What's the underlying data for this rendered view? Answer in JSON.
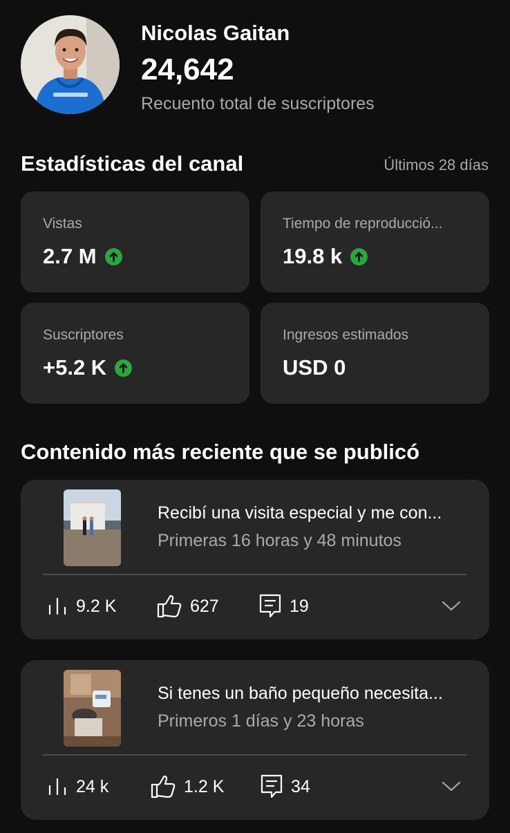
{
  "channel": {
    "name": "Nicolas Gaitan",
    "subscribers": "24,642",
    "subscribers_label": "Recuento total de suscriptores"
  },
  "stats": {
    "title": "Estadísticas del canal",
    "period": "Últimos 28 días",
    "cards": [
      {
        "label": "Vistas",
        "value": "2.7 M",
        "trend": "up"
      },
      {
        "label": "Tiempo de reproducció...",
        "value": "19.8 k",
        "trend": "up"
      },
      {
        "label": "Suscriptores",
        "value": "+5.2 K",
        "trend": "up"
      },
      {
        "label": "Ingresos estimados",
        "value": "USD 0",
        "trend": "none"
      }
    ]
  },
  "recent": {
    "title": "Contenido más reciente que se publicó",
    "items": [
      {
        "title": "Recibí una visita especial y me con...",
        "time": "Primeras 16 horas y 48 minutos",
        "views": "9.2 K",
        "likes": "627",
        "comments": "19"
      },
      {
        "title": "Si tenes un baño pequeño necesita...",
        "time": "Primeros 1 días y 23 horas",
        "views": "24 k",
        "likes": "1.2 K",
        "comments": "34"
      }
    ]
  },
  "colors": {
    "background": "#0f0f0f",
    "card": "#272727",
    "secondary_text": "#aaaaaa",
    "trend_up": "#2ba640"
  }
}
